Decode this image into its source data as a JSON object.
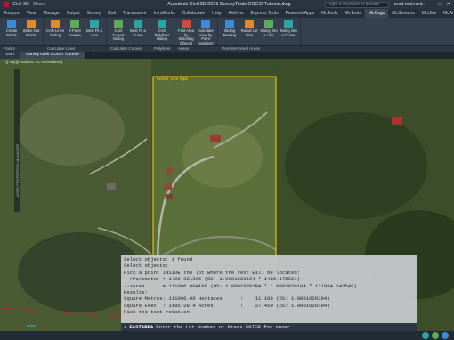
{
  "titlebar": {
    "app_menu_icon": "autodesk-a-icon",
    "qat_label": "Civil 3D",
    "share_label": "Share",
    "title": "Autodesk Civil 3D 2023   SurveyTools COGO Tutorial.dwg",
    "search_placeholder": "Type a keyword or phrase",
    "user": "matt.mcleard..."
  },
  "ribbon_tabs": [
    "Analyze",
    "View",
    "Manage",
    "Output",
    "Survey",
    "Rail",
    "Transparent",
    "InfraWorks",
    "Collaborate",
    "Help",
    "Add-ins",
    "Express Tools",
    "Featured Apps",
    "McTools",
    "McTools",
    "McCogo",
    "McStreams",
    "McUtils",
    "McAnnotate",
    "McMeasure",
    "McDesign",
    "McHelp"
  ],
  "active_tab_index": 15,
  "ribbon_groups": [
    {
      "title": "Points",
      "buttons": [
        "Create Points",
        "Stake Out Points"
      ]
    },
    {
      "title": "Calculate Lines",
      "buttons": [
        "CAD Lines Dialog",
        "2-Point Inverse",
        "Best Fit a Line"
      ]
    },
    {
      "title": "Calculate Curves",
      "buttons": [
        "CAD Curves Dialog",
        "Best Fit a Curve"
      ]
    },
    {
      "title": "Polylines",
      "buttons": [
        "CAD Polylines Dialog"
      ]
    },
    {
      "title": "Areas",
      "buttons": [
        "Fast Area by Selecting Objects",
        "Calculate Area by Point Numbers"
      ]
    },
    {
      "title": "Predetermined Areas",
      "buttons": [
        "Sliding Bearing",
        "Radial Lot Line",
        "Swing into a Line",
        "Swing into a Curve"
      ]
    }
  ],
  "doc_tabs": [
    "Start",
    "SurveyTools COGO Tutorial*"
  ],
  "viewport": {
    "view_label": "[-][Top][Realistic 2D Wireframe]",
    "side_toolbar_label": "LAYER PROPERTIES MANAGER",
    "parcel_label": "Fence, Iron Pipe"
  },
  "command_window": {
    "lines": [
      "Select objects: 1 found",
      "Select objects:",
      "Pick a point INSIDE the lot where the text will be located:",
      "-->Perimeter = 1426.321305 (OS: 1.0001020104 * 1426.175021)",
      "-->Area      = 111006.004100 (OS: 1.0001020104 * 1.0001020104 * 111064.143548)",
      "Results:",
      "Square Metres: 111006.00 Hectares      :    11.109 (OS: 1.0001020104)",
      "Square Feet  : 1195728.4 Acres         :    27.450 (OS: 1.0001020104)",
      "Pick the text rotation:"
    ],
    "close_glyph": "✕",
    "command_name": "FASTAREA",
    "prompt": "Enter the Lot Number or Press ENTER for none:"
  },
  "colors": {
    "accent": "#3f8ad6",
    "parcel": "#ffd400",
    "command_bg": "#c6c8ca"
  }
}
